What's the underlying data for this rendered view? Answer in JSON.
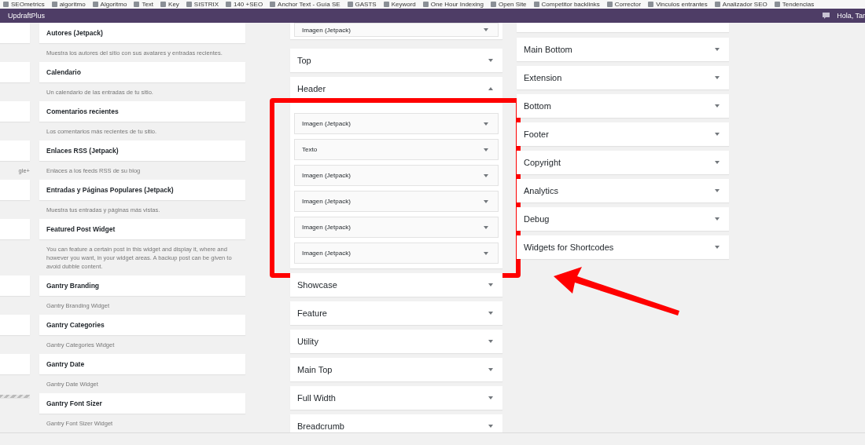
{
  "bookmarks": [
    "SEOmetrics",
    "algoritmo",
    "Algoritmo",
    "Text",
    "Key",
    "SISTRIX",
    "140 +SEO",
    "Anchor Text - Guía SE",
    "GASTS",
    "Keyword",
    "One Hour Indexing",
    "Open Site",
    "Competitor backlinks",
    "Corrector",
    "Vinculos entrantes",
    "Analizador SEO",
    "Tendencias"
  ],
  "admin_bar": {
    "site": "UpdraftPlus",
    "greeting": "Hola, Tar"
  },
  "available_widgets": [
    {
      "title": "Autores (Jetpack)",
      "description": "Muestra los autores del sitio con sus avatares y entradas recientes.",
      "clipped": {
        "kind": "card"
      }
    },
    {
      "title": "Calendario",
      "description": "Un calendario de las entradas de tu sitio.",
      "clipped": {
        "kind": "card"
      }
    },
    {
      "title": "Comentarios recientes",
      "description": "Los comentarios más recientes de tu sitio.",
      "clipped": {
        "kind": "card"
      }
    },
    {
      "title": "Enlaces RSS (Jetpack)",
      "description": "Enlaces a los feeds RSS de su blog",
      "clipped": {
        "kind": "card",
        "description": "gle+"
      }
    },
    {
      "title": "Entradas y Páginas Populares (Jetpack)",
      "description": "Muestra tus entradas y páginas más vistas.",
      "clipped": {
        "kind": "card"
      }
    },
    {
      "title": "Featured Post Widget",
      "description": "You can feature a certain post in this widget and display it, where and however you want, in your widget areas. A backup post can be given to avoid dubble content.",
      "clipped": {
        "kind": "card"
      }
    },
    {
      "title": "Gantry Branding",
      "description": "Gantry Branding Widget",
      "clipped": {
        "kind": "card"
      }
    },
    {
      "title": "Gantry Categories",
      "description": "Gantry Categories Widget",
      "clipped": {
        "kind": "card"
      }
    },
    {
      "title": "Gantry Date",
      "description": "Gantry Date Widget",
      "clipped": {
        "kind": "card"
      }
    },
    {
      "title": "Gantry Font Sizer",
      "description": "Gantry Font Sizer Widget",
      "clipped": {
        "kind": "placeholder"
      }
    }
  ],
  "sidebar_columns": [
    {
      "partial_top": {
        "kind": "expanded",
        "widgets": [
          "Imagen (Jetpack)"
        ]
      },
      "sidebars": [
        {
          "title": "Top",
          "expanded": false
        },
        {
          "title": "Header",
          "expanded": true,
          "widgets": [
            "Imagen (Jetpack)",
            "Texto",
            "Imagen (Jetpack)",
            "Imagen (Jetpack)",
            "Imagen (Jetpack)",
            "Imagen (Jetpack)"
          ]
        },
        {
          "title": "Showcase",
          "expanded": false
        },
        {
          "title": "Feature",
          "expanded": false
        },
        {
          "title": "Utility",
          "expanded": false
        },
        {
          "title": "Main Top",
          "expanded": false
        },
        {
          "title": "Full Width",
          "expanded": false
        },
        {
          "title": "Breadcrumb",
          "expanded": false
        }
      ]
    },
    {
      "partial_top": {
        "kind": "collapsed"
      },
      "sidebars": [
        {
          "title": "Main Bottom",
          "expanded": false
        },
        {
          "title": "Extension",
          "expanded": false
        },
        {
          "title": "Bottom",
          "expanded": false
        },
        {
          "title": "Footer",
          "expanded": false
        },
        {
          "title": "Copyright",
          "expanded": false
        },
        {
          "title": "Analytics",
          "expanded": false
        },
        {
          "title": "Debug",
          "expanded": false
        },
        {
          "title": "Widgets for Shortcodes",
          "expanded": false
        }
      ]
    }
  ],
  "annotations": {
    "highlight_frame": true,
    "pointer_arrow": true
  }
}
